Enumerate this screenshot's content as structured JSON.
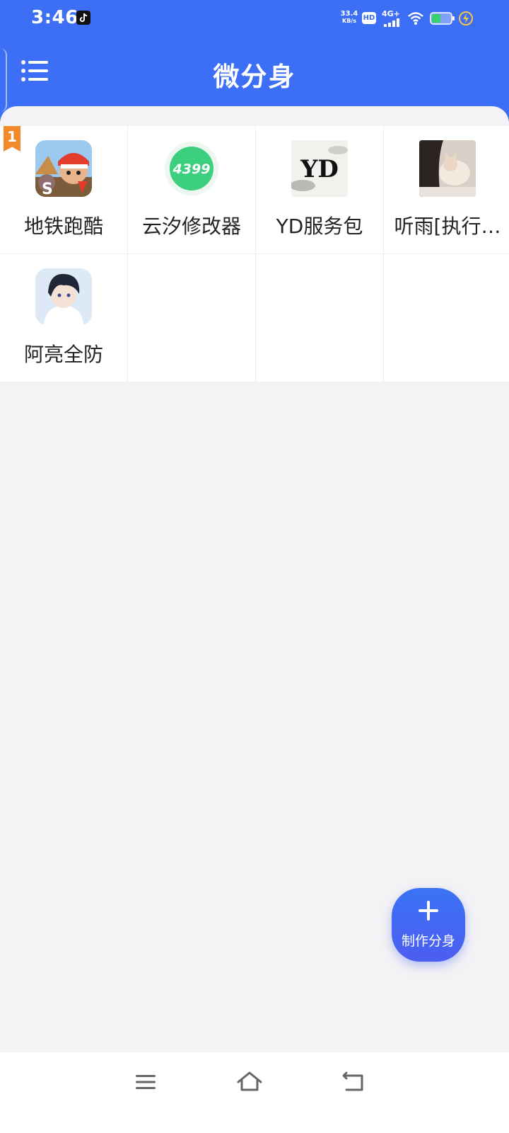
{
  "status_bar": {
    "time": "3:46",
    "net_speed_value": "33.4",
    "net_speed_unit": "KB/s",
    "hd_badge": "HD",
    "network_type": "4G+",
    "icons": [
      "tiktok-icon",
      "hd-icon",
      "signal-icon",
      "wifi-icon",
      "battery-icon",
      "charging-icon"
    ]
  },
  "header": {
    "title": "微分身",
    "menu_icon": "list-menu-icon"
  },
  "apps": [
    {
      "label": "地铁跑酷",
      "rank_badge": "1",
      "icon": "subway-surfers-icon"
    },
    {
      "label": "云汐修改器",
      "icon": "4399-icon",
      "icon_text": "4399"
    },
    {
      "label": "YD服务包",
      "icon": "yd-logo-icon",
      "icon_text": "YD"
    },
    {
      "label": "听雨[执行…",
      "icon": "photo-cat-icon"
    },
    {
      "label": "阿亮全防",
      "icon": "anime-avatar-icon"
    }
  ],
  "fab": {
    "label": "制作分身",
    "icon": "plus-icon"
  },
  "nav_bar": {
    "icons": [
      "menu-lines-icon",
      "home-icon",
      "back-icon"
    ]
  },
  "colors": {
    "primary": "#3d6ef6",
    "background": "#f4f2f5",
    "badge": "#f28a2c",
    "icon_4399": "#3ccf7d"
  }
}
